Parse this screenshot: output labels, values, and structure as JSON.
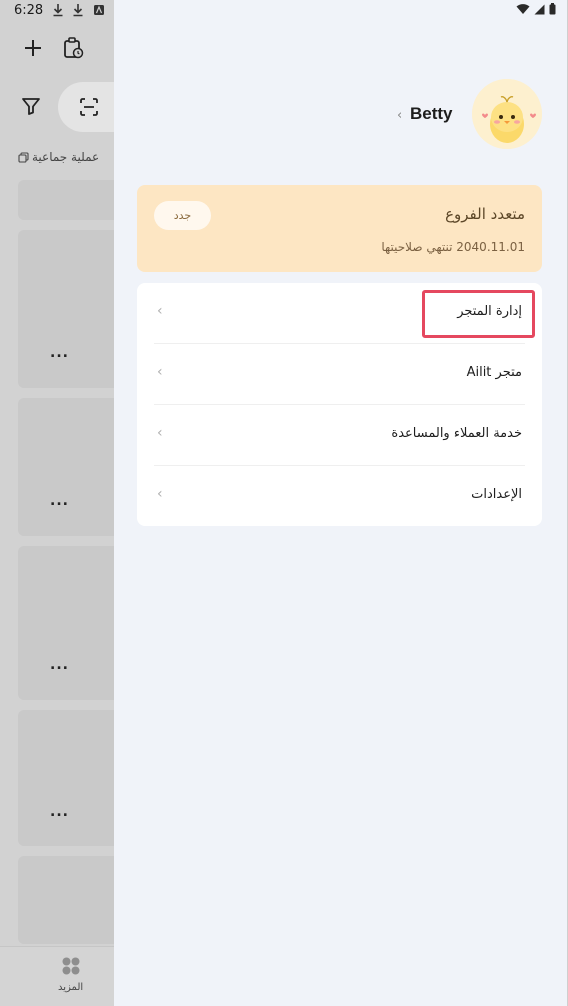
{
  "status_bar": {
    "time": "6:28"
  },
  "background": {
    "group_operation_label": "عملية جماعية",
    "more_label": "المزيد",
    "more_icon": "clover-grid-icon",
    "list_dots": [
      "...",
      "...",
      "...",
      "..."
    ]
  },
  "drawer": {
    "user": {
      "name": "Betty",
      "chevron": "‹"
    },
    "plan": {
      "title": "متعدد الفروع",
      "expiry": "2040.11.01 تنتهي صلاحيتها",
      "renew_label": "جدد"
    },
    "menu": {
      "chevron": "‹",
      "items": [
        {
          "label": "إدارة المتجر",
          "icon": "chevron-left-icon"
        },
        {
          "label": "Ailit متجر",
          "icon": "chevron-left-icon"
        },
        {
          "label": "خدمة العملاء والمساعدة",
          "icon": "chevron-left-icon"
        },
        {
          "label": "الإعدادات",
          "icon": "chevron-left-icon"
        }
      ]
    }
  },
  "colors": {
    "highlight": "#e5485f",
    "plan_card": "#fde6c3",
    "drawer_bg": "#f0f3f9"
  }
}
